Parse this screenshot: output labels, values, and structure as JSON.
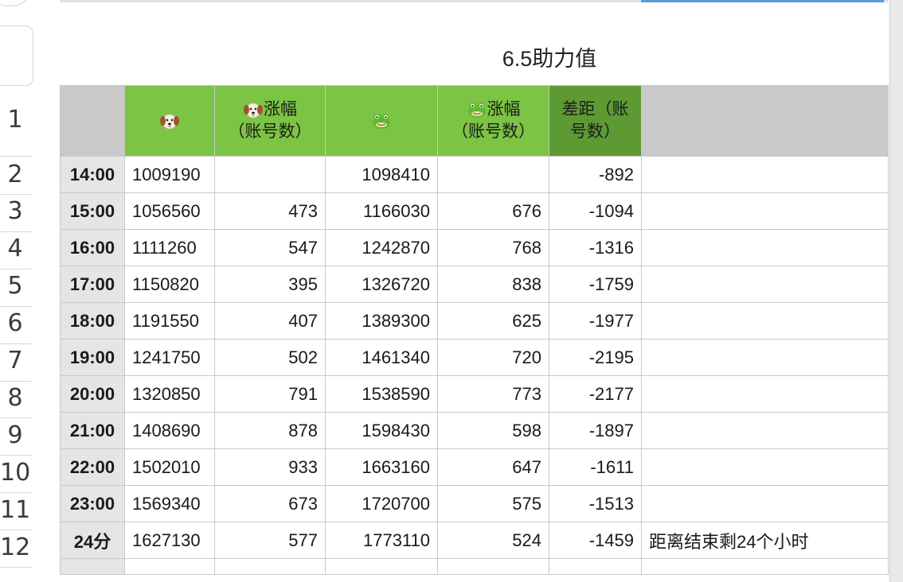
{
  "title": "6.5助力值",
  "row_numbers": [
    "1",
    "2",
    "3",
    "4",
    "5",
    "6",
    "7",
    "8",
    "9",
    "10",
    "11",
    "12"
  ],
  "header": {
    "dog_icon": "dog-face-icon",
    "frog_icon": "frog-face-icon",
    "dog_gain_line1": "涨幅",
    "dog_gain_line2": "（账号数）",
    "frog_gain_line1": "涨幅",
    "frog_gain_line2": "（账号数）",
    "diff_line1": "差距（账",
    "diff_line2": "号数）"
  },
  "rows": [
    {
      "time": "14:00",
      "dog": "1009190",
      "dog_gain": "",
      "frog": "1098410",
      "frog_gain": "",
      "diff": "-892",
      "note": ""
    },
    {
      "time": "15:00",
      "dog": "1056560",
      "dog_gain": "473",
      "frog": "1166030",
      "frog_gain": "676",
      "diff": "-1094",
      "note": ""
    },
    {
      "time": "16:00",
      "dog": "1111260",
      "dog_gain": "547",
      "frog": "1242870",
      "frog_gain": "768",
      "diff": "-1316",
      "note": ""
    },
    {
      "time": "17:00",
      "dog": "1150820",
      "dog_gain": "395",
      "frog": "1326720",
      "frog_gain": "838",
      "diff": "-1759",
      "note": ""
    },
    {
      "time": "18:00",
      "dog": "1191550",
      "dog_gain": "407",
      "frog": "1389300",
      "frog_gain": "625",
      "diff": "-1977",
      "note": ""
    },
    {
      "time": "19:00",
      "dog": "1241750",
      "dog_gain": "502",
      "frog": "1461340",
      "frog_gain": "720",
      "diff": "-2195",
      "note": ""
    },
    {
      "time": "20:00",
      "dog": "1320850",
      "dog_gain": "791",
      "frog": "1538590",
      "frog_gain": "773",
      "diff": "-2177",
      "note": ""
    },
    {
      "time": "21:00",
      "dog": "1408690",
      "dog_gain": "878",
      "frog": "1598430",
      "frog_gain": "598",
      "diff": "-1897",
      "note": ""
    },
    {
      "time": "22:00",
      "dog": "1502010",
      "dog_gain": "933",
      "frog": "1663160",
      "frog_gain": "647",
      "diff": "-1611",
      "note": ""
    },
    {
      "time": "23:00",
      "dog": "1569340",
      "dog_gain": "673",
      "frog": "1720700",
      "frog_gain": "575",
      "diff": "-1513",
      "note": ""
    },
    {
      "time": "24分",
      "dog": "1627130",
      "dog_gain": "577",
      "frog": "1773110",
      "frog_gain": "524",
      "diff": "-1459",
      "note": "距离结束剩24个小时"
    }
  ],
  "colors": {
    "header_green": "#7cc443",
    "header_dark_green": "#5d9a34",
    "header_gray": "#c9c9c9",
    "time_cell": "#e5e5e5"
  }
}
